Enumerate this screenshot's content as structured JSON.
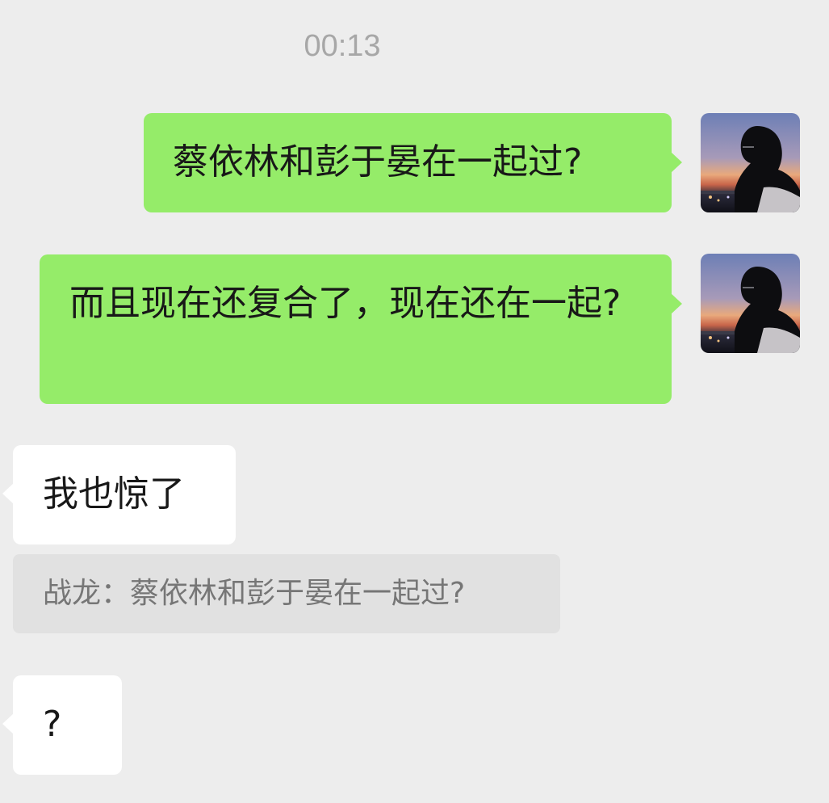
{
  "timestamp": "00:13",
  "messages": [
    {
      "sender": "self",
      "text": "蔡依林和彭于晏在一起过?"
    },
    {
      "sender": "self",
      "text": "而且现在还复合了，现在还在一起?"
    },
    {
      "sender": "other",
      "text": "我也惊了"
    },
    {
      "sender": "other",
      "text": "?"
    }
  ],
  "quote": {
    "author": "战龙",
    "separator": "：",
    "text": "蔡依林和彭于晏在一起过?"
  },
  "colors": {
    "background": "#ededed",
    "self_bubble": "#95ec69",
    "other_bubble": "#ffffff",
    "quote_bubble": "#e1e1e1",
    "timestamp_text": "#a7a7a7",
    "quote_text": "#767676"
  },
  "avatar": {
    "description": "silhouette-at-sunset-avatar"
  }
}
